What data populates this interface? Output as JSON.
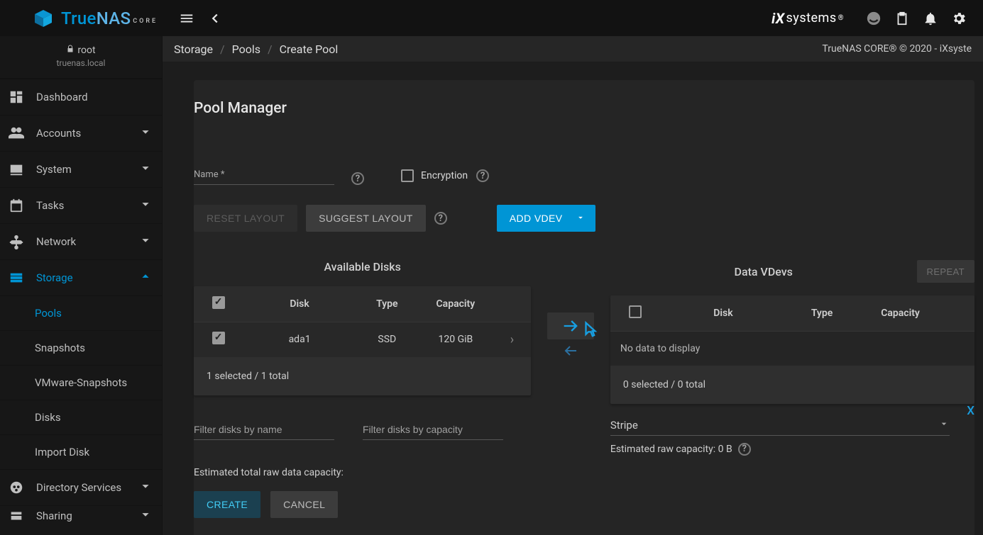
{
  "brand": {
    "true": "True",
    "nas": "NAS",
    "core": "CORE"
  },
  "user": {
    "name": "root",
    "host": "truenas.local"
  },
  "sidebar": {
    "items": [
      {
        "label": "Dashboard"
      },
      {
        "label": "Accounts"
      },
      {
        "label": "System"
      },
      {
        "label": "Tasks"
      },
      {
        "label": "Network"
      },
      {
        "label": "Storage"
      },
      {
        "label": "Directory Services"
      },
      {
        "label": "Sharing"
      }
    ],
    "storage_children": [
      {
        "label": "Pools"
      },
      {
        "label": "Snapshots"
      },
      {
        "label": "VMware-Snapshots"
      },
      {
        "label": "Disks"
      },
      {
        "label": "Import Disk"
      }
    ]
  },
  "breadcrumbs": [
    "Storage",
    "Pools",
    "Create Pool"
  ],
  "copyright": "TrueNAS CORE® © 2020 - iXsyste",
  "page_title": "Pool Manager",
  "name_label": "Name *",
  "encryption_label": "Encryption",
  "buttons": {
    "reset": "RESET LAYOUT",
    "suggest": "SUGGEST LAYOUT",
    "addvdev": "ADD VDEV",
    "repeat": "REPEAT",
    "create": "CREATE",
    "cancel": "CANCEL"
  },
  "available": {
    "title": "Available Disks",
    "headers": {
      "disk": "Disk",
      "type": "Type",
      "capacity": "Capacity"
    },
    "rows": [
      {
        "disk": "ada1",
        "type": "SSD",
        "capacity": "120 GiB"
      }
    ],
    "status": "1 selected / 1 total",
    "filter_name_ph": "Filter disks by name",
    "filter_cap_ph": "Filter disks by capacity"
  },
  "vdevs": {
    "title": "Data VDevs",
    "headers": {
      "disk": "Disk",
      "type": "Type",
      "capacity": "Capacity"
    },
    "nodata": "No data to display",
    "status": "0 selected / 0 total",
    "layout": "Stripe",
    "rawcap": "Estimated raw capacity: 0 B",
    "x": "X"
  },
  "estimate": "Estimated total raw data capacity:"
}
